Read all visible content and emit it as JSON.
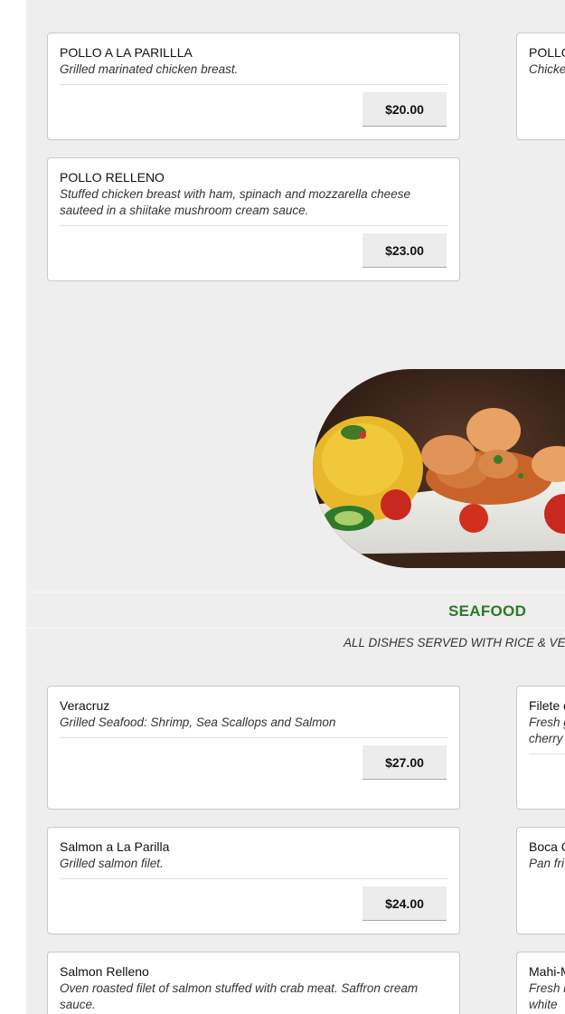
{
  "chicken": {
    "items": [
      {
        "name": "POLLO A LA PARILLLA",
        "description": "Grilled marinated chicken breast.",
        "price": "$20.00"
      },
      {
        "name": "POLLO RELLENO",
        "description": "Stuffed chicken breast with ham, spinach and mozzarella cheese sauteed in a shiitake mushroom cream sauce.",
        "price": "$23.00"
      }
    ],
    "side_items": [
      {
        "name": "POLLO",
        "description": "Chicke"
      }
    ]
  },
  "seafood": {
    "title": "SEAFOOD",
    "note": "ALL DISHES SERVED WITH RICE & VE",
    "items": [
      {
        "name": "Veracruz",
        "description": "Grilled Seafood: Shrimp, Sea Scallops and Salmon",
        "price": "$27.00"
      },
      {
        "name": "Salmon a La Parilla",
        "description": "Grilled salmon filet.",
        "price": "$24.00"
      },
      {
        "name": "Salmon Relleno",
        "description": "Oven roasted filet of salmon stuffed with crab meat. Saffron cream sauce."
      }
    ],
    "side_items": [
      {
        "name": "Filete d",
        "description": "Fresh g cherry"
      },
      {
        "name": "Boca C",
        "description": "Pan fri"
      },
      {
        "name": "Mahi-M",
        "description": "Fresh m white"
      }
    ]
  },
  "image": {
    "icon": "shrimp-rice-plate-photo"
  }
}
